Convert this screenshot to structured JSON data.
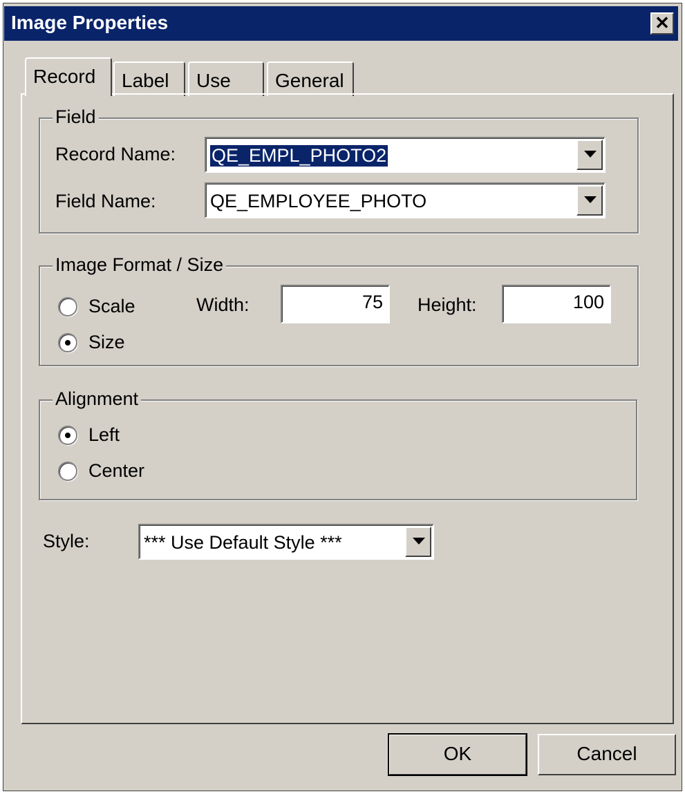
{
  "dialog": {
    "title": "Image Properties",
    "close_glyph": "✕"
  },
  "tabs": [
    {
      "label": "Record",
      "active": true
    },
    {
      "label": "Label",
      "active": false
    },
    {
      "label": "Use",
      "active": false
    },
    {
      "label": "General",
      "active": false
    }
  ],
  "field_group": {
    "legend": "Field",
    "record_name_label": "Record Name:",
    "record_name_value": "QE_EMPL_PHOTO2",
    "field_name_label": "Field Name:",
    "field_name_value": "QE_EMPLOYEE_PHOTO"
  },
  "format_group": {
    "legend": "Image Format / Size",
    "scale_label": "Scale",
    "size_label": "Size",
    "selected": "Size",
    "width_label": "Width:",
    "width_value": "75",
    "height_label": "Height:",
    "height_value": "100"
  },
  "alignment_group": {
    "legend": "Alignment",
    "left_label": "Left",
    "center_label": "Center",
    "selected": "Left"
  },
  "style": {
    "label": "Style:",
    "value": "*** Use Default Style ***"
  },
  "buttons": {
    "ok": "OK",
    "cancel": "Cancel"
  },
  "colors": {
    "titlebar": "#0a246a",
    "face": "#d4d0c8",
    "selection": "#0a246a"
  }
}
